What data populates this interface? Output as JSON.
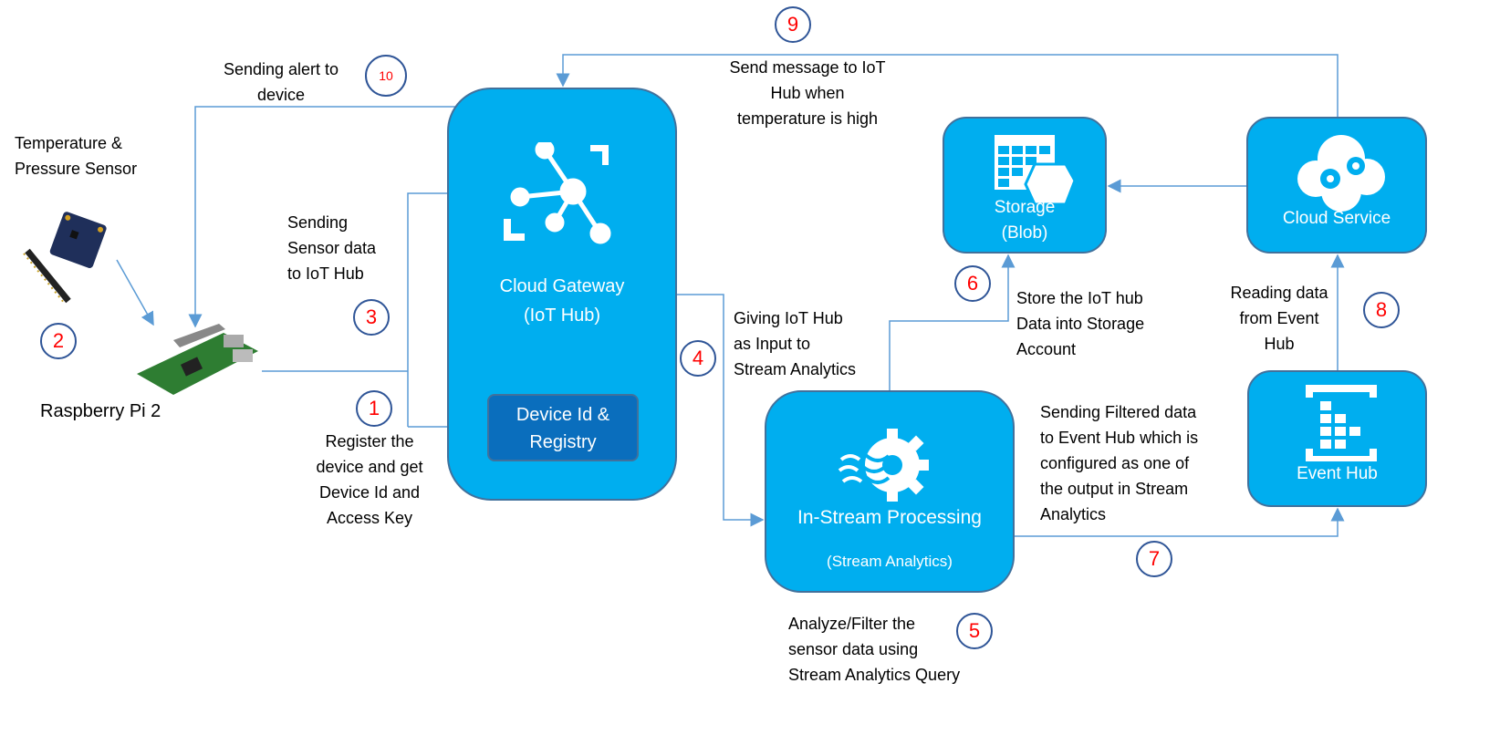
{
  "colors": {
    "box_fill": "#00AEEF",
    "box_border": "#41719C",
    "registry_fill": "#0A6EBD",
    "step_number": "#FF0000",
    "connector": "#5B9BD5"
  },
  "nodes": {
    "iot_hub": {
      "line1": "Cloud Gateway",
      "line2": "(IoT Hub)",
      "icon": "iot-hub-icon"
    },
    "registry": {
      "line1": "Device Id &",
      "line2": "Registry"
    },
    "storage": {
      "line1": "Storage",
      "line2": "(Blob)",
      "icon": "storage-table-icon"
    },
    "cloud_service": {
      "label": "Cloud Service",
      "icon": "cloud-gears-icon"
    },
    "stream": {
      "line1": "In-Stream Processing",
      "line2": "(Stream Analytics)",
      "icon": "stream-analytics-icon"
    },
    "event_hub": {
      "label": "Event Hub",
      "icon": "event-hub-icon"
    },
    "sensor": {
      "line1": "Temperature &",
      "line2": "Pressure Sensor"
    },
    "pi": {
      "label": "Raspberry Pi 2"
    }
  },
  "steps": {
    "s1": "1",
    "s2": "2",
    "s3": "3",
    "s4": "4",
    "s5": "5",
    "s6": "6",
    "s7": "7",
    "s8": "8",
    "s9": "9",
    "s10": "10"
  },
  "annotations": {
    "alert": [
      "Sending alert to",
      "device"
    ],
    "send_msg": [
      "Send message to IoT",
      "Hub when",
      "temperature is high"
    ],
    "send_sensor": [
      "Sending",
      "Sensor data",
      "to IoT Hub"
    ],
    "register": [
      "Register the",
      "device and get",
      "Device Id and",
      "Access Key"
    ],
    "giving": [
      "Giving IoT Hub",
      "as Input to",
      "Stream Analytics"
    ],
    "store": [
      "Store the IoT hub",
      "Data into Storage",
      "Account"
    ],
    "reading": [
      "Reading data",
      "from Event",
      "Hub"
    ],
    "filtered": [
      "Sending Filtered data",
      "to Event Hub which is",
      "configured as one of",
      "the output in Stream",
      "Analytics"
    ],
    "analyze": [
      "Analyze/Filter the",
      "sensor data using",
      "Stream Analytics Query"
    ]
  }
}
